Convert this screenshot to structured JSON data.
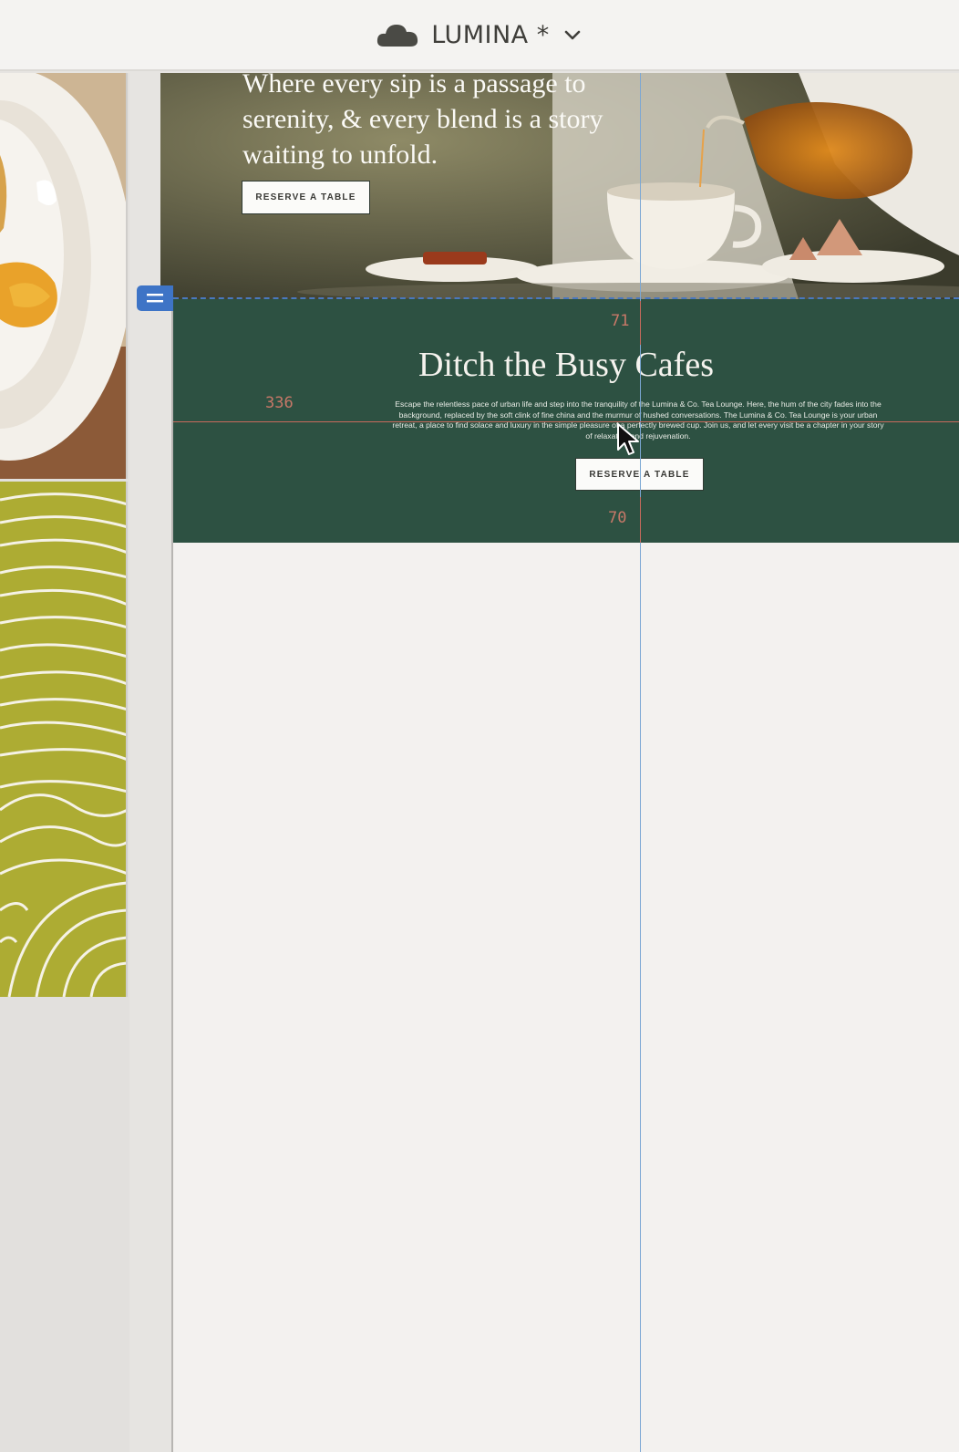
{
  "topbar": {
    "doc_name": "LUMINA",
    "unsaved_marker": "*",
    "cloud_icon": "cloud-icon",
    "menu_icon": "chevron-down-icon"
  },
  "hero": {
    "tagline": "Where every sip is a passage to serenity, & every blend is a story waiting to unfold.",
    "button_label": "RESERVE A TABLE"
  },
  "section": {
    "heading": "Ditch the Busy Cafes",
    "body": "Escape the relentless pace of urban life and step into the tranquility of the Lumina & Co. Tea Lounge. Here, the hum of the city fades into the background, replaced by the soft clink of fine china and the murmur of hushed conversations. The Lumina & Co. Tea Lounge is your urban retreat, a place to find solace and luxury in the simple pleasure of a perfectly brewed cup. Join us, and let every visit be a chapter in your story of relaxation and rejuvenation.",
    "button_label": "RESERVE A TABLE"
  },
  "measurements": {
    "top": "71",
    "left": "336",
    "bottom": "70"
  },
  "colors": {
    "section_bg": "#2d5142",
    "guide_blue": "#7ba7d4",
    "guide_red": "#c86a5c",
    "selection": "#3e74c6"
  }
}
